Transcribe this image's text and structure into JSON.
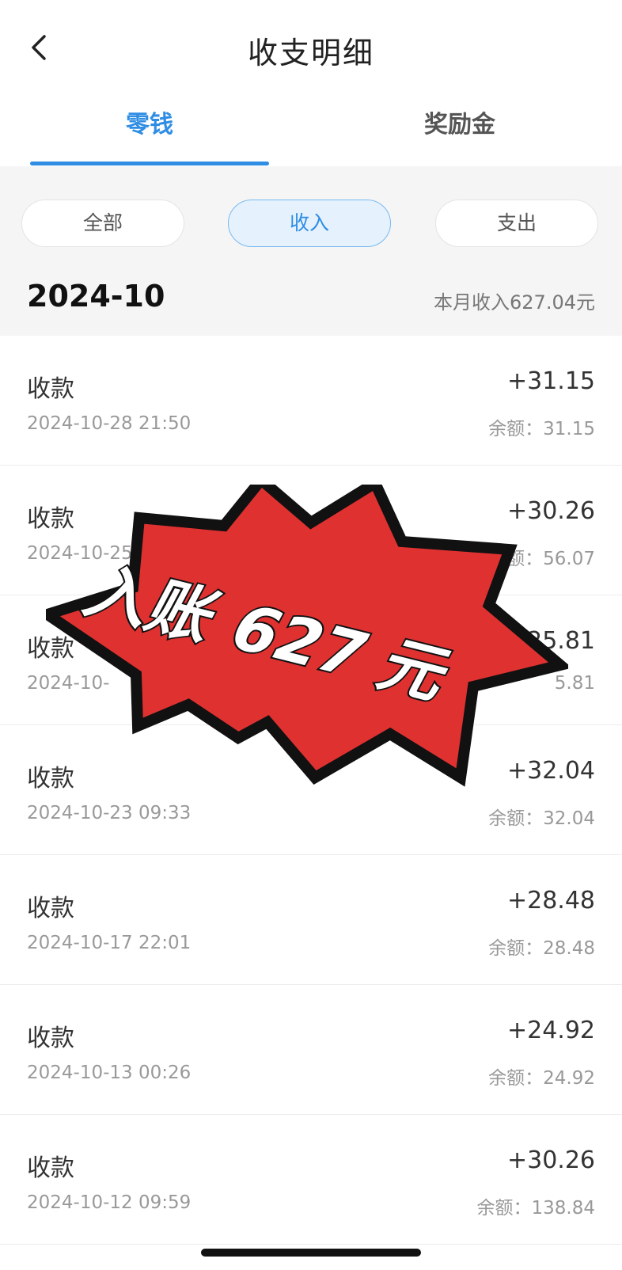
{
  "header": {
    "title": "收支明细",
    "back_icon": "chevron-left-icon"
  },
  "tabs": [
    {
      "label": "零钱",
      "active": true
    },
    {
      "label": "奖励金",
      "active": false
    }
  ],
  "filters": [
    {
      "label": "全部",
      "active": false
    },
    {
      "label": "收入",
      "active": true
    },
    {
      "label": "支出",
      "active": false
    }
  ],
  "month": {
    "label": "2024-10",
    "summary": "本月收入627.04元"
  },
  "transactions": [
    {
      "title": "收款",
      "time": "2024-10-28 21:50",
      "amount": "+31.15",
      "balance": "余额：31.15"
    },
    {
      "title": "收款",
      "time": "2024-10-25",
      "amount": "+30.26",
      "balance": "余额：56.07"
    },
    {
      "title": "收款",
      "time": "2024-10-",
      "amount": "+25.81",
      "balance": "5.81"
    },
    {
      "title": "收款",
      "time": "2024-10-23 09:33",
      "amount": "+32.04",
      "balance": "余额：32.04"
    },
    {
      "title": "收款",
      "time": "2024-10-17 22:01",
      "amount": "+28.48",
      "balance": "余额：28.48"
    },
    {
      "title": "收款",
      "time": "2024-10-13 00:26",
      "amount": "+24.92",
      "balance": "余额：24.92"
    },
    {
      "title": "收款",
      "time": "2024-10-12 09:59",
      "amount": "+30.26",
      "balance": "余额：138.84"
    }
  ],
  "sticker": {
    "text": "入账 627 元",
    "fill_color": "#e03131",
    "outline_color": "#111111"
  },
  "colors": {
    "accent": "#2f8de4"
  }
}
